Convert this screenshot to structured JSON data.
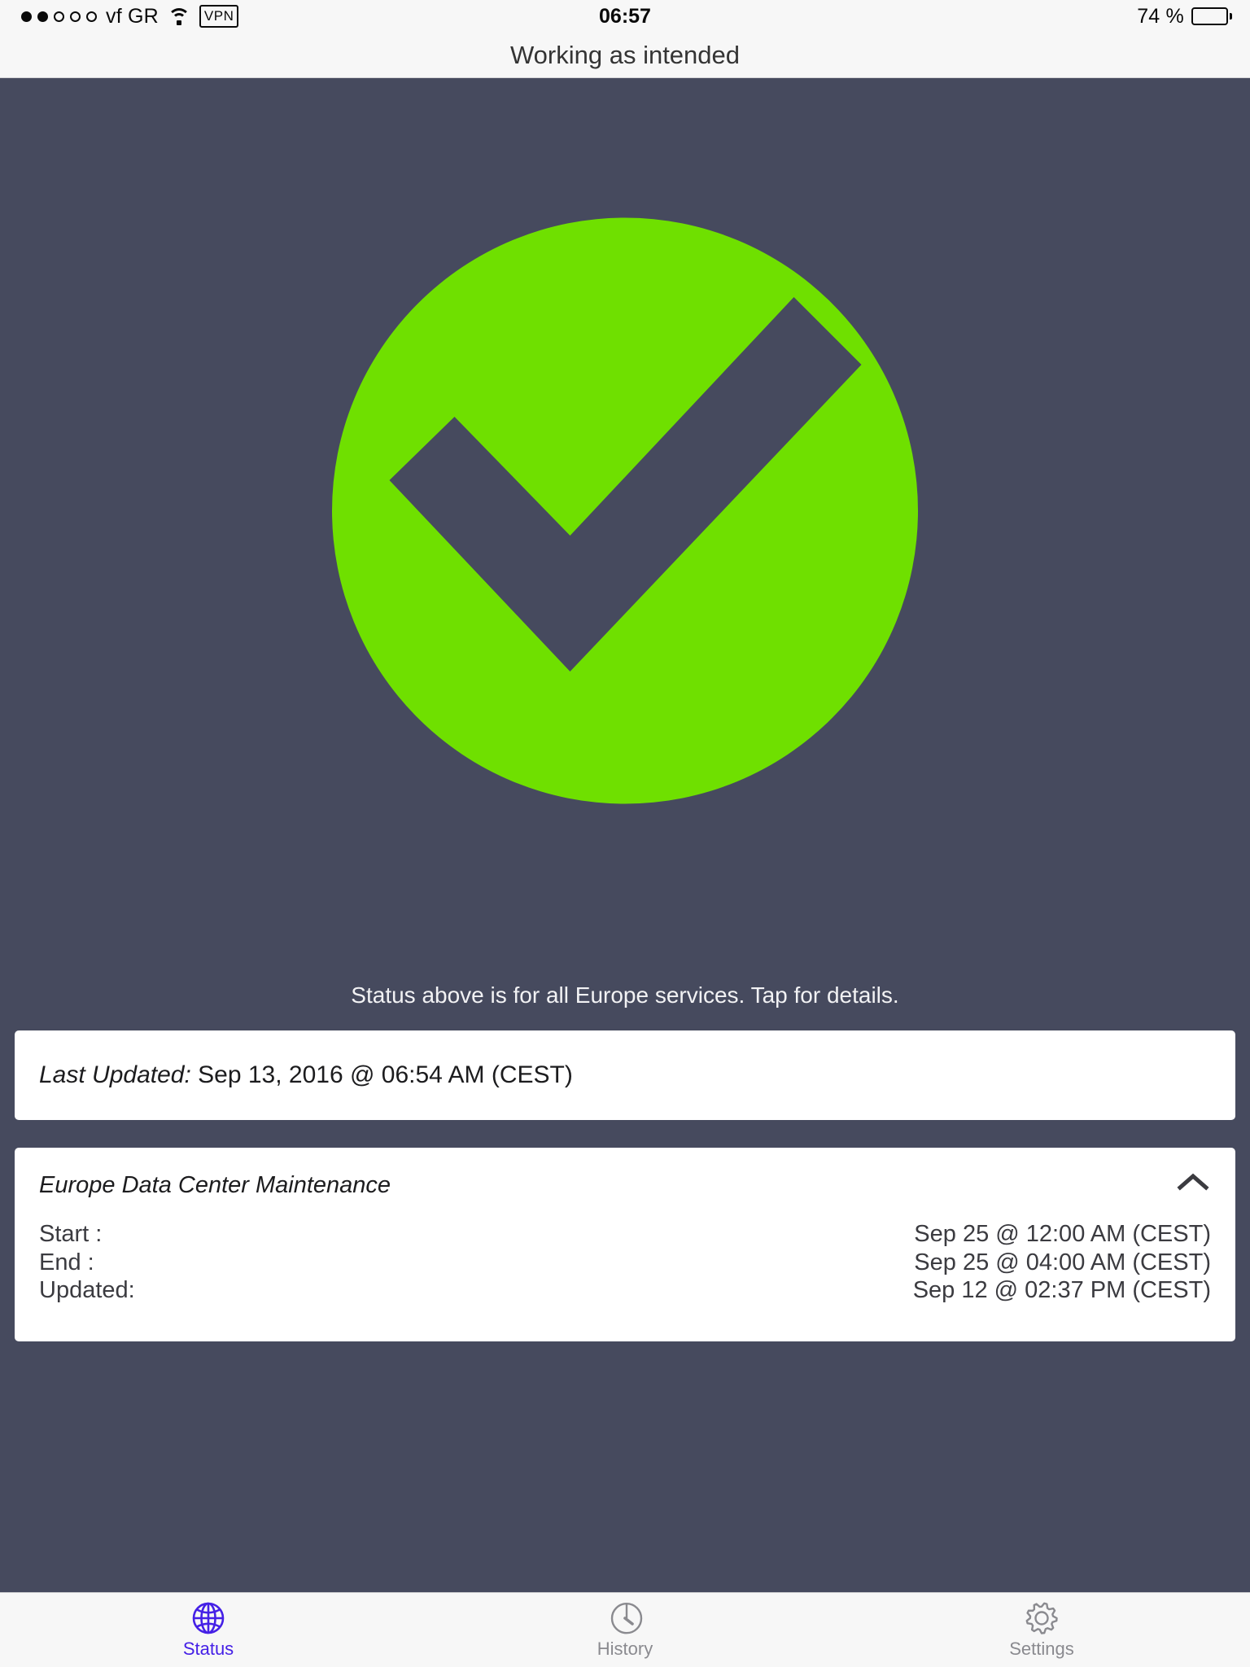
{
  "status_bar": {
    "carrier": "vf GR",
    "signal_filled": 2,
    "signal_total": 5,
    "wifi_icon": "wifi-icon",
    "vpn_label": "VPN",
    "time": "06:57",
    "battery_label": "74 %",
    "battery_percent": 74
  },
  "nav": {
    "title": "Working as intended"
  },
  "status": {
    "icon": "check-circle-icon",
    "circle_color": "#6fe000",
    "background_color": "#464a5e",
    "note": "Status above is for all Europe services. Tap for details."
  },
  "last_updated_card": {
    "label": "Last Updated:",
    "value": "Sep 13, 2016 @ 06:54 AM (CEST)"
  },
  "maintenance_card": {
    "title": "Europe Data Center Maintenance",
    "collapse_icon": "chevron-up-icon",
    "rows": [
      {
        "label": "Start :",
        "value": "Sep 25 @ 12:00 AM (CEST)"
      },
      {
        "label": "End :",
        "value": "Sep 25 @ 04:00 AM (CEST)"
      },
      {
        "label": "Updated:",
        "value": "Sep 12 @ 02:37 PM (CEST)"
      }
    ]
  },
  "tabbar": {
    "active_color": "#4520e6",
    "inactive_color": "#8a8a8f",
    "tabs": [
      {
        "label": "Status",
        "icon": "globe-icon",
        "active": true
      },
      {
        "label": "History",
        "icon": "clock-icon",
        "active": false
      },
      {
        "label": "Settings",
        "icon": "gear-icon",
        "active": false
      }
    ]
  }
}
